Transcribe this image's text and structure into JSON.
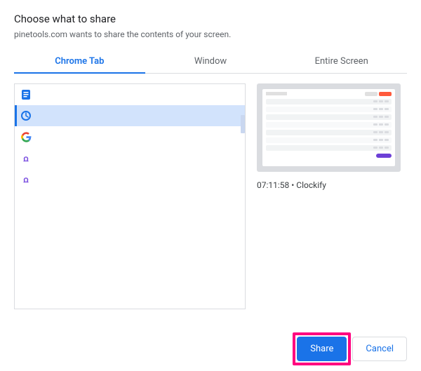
{
  "header": {
    "title": "Choose what to share",
    "subtitle": "pinetools.com wants to share the contents of your screen."
  },
  "tabs": {
    "chrome_tab": "Chrome Tab",
    "window": "Window",
    "entire_screen": "Entire Screen"
  },
  "tab_list": {
    "items": [
      {
        "icon": "document-icon"
      },
      {
        "icon": "clockify-icon"
      },
      {
        "icon": "google-icon"
      },
      {
        "icon": "app-a-icon"
      },
      {
        "icon": "app-a-icon"
      }
    ],
    "selected_index": 1
  },
  "preview": {
    "label": "07:11:58 • Clockify"
  },
  "footer": {
    "share": "Share",
    "cancel": "Cancel"
  },
  "highlight": {
    "target": "share-button"
  }
}
